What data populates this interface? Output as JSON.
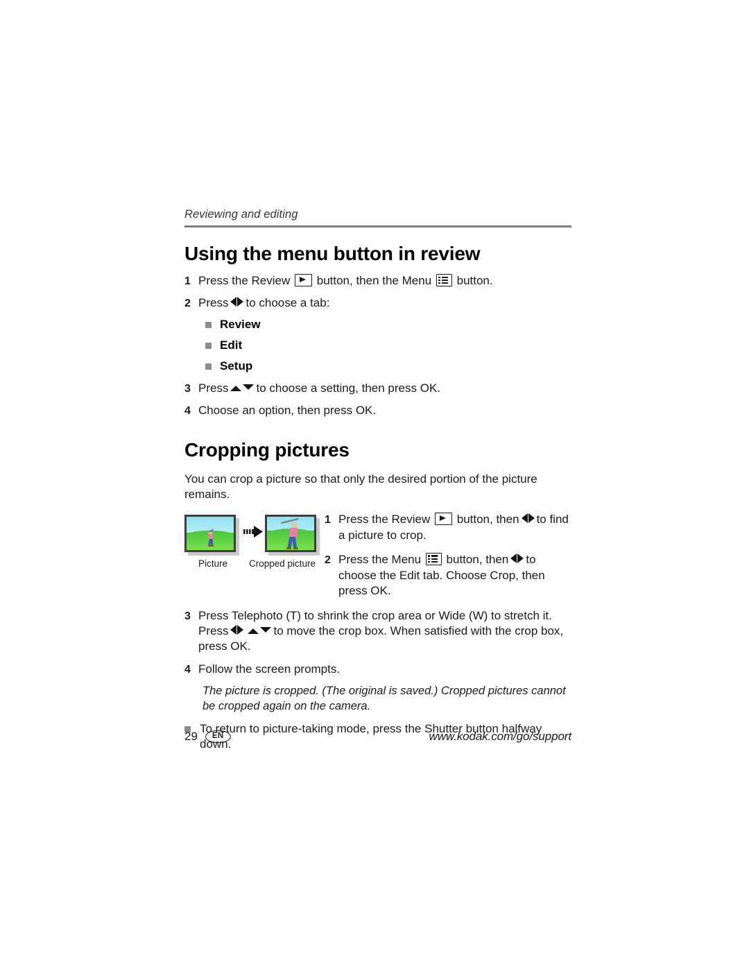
{
  "header": {
    "running_title": "Reviewing and editing"
  },
  "sections": [
    {
      "title": "Using the menu button in review",
      "steps": [
        {
          "num": "1",
          "text_a": "Press the Review",
          "text_b": "button, then the Menu",
          "text_c": "button."
        },
        {
          "num": "2",
          "text_a": "Press",
          "text_b": "to choose a tab:"
        }
      ],
      "tabs": [
        {
          "label": "Review"
        },
        {
          "label": "Edit"
        },
        {
          "label": "Setup"
        }
      ],
      "steps_after": [
        {
          "num": "3",
          "text_a": "Press",
          "text_b": "to choose a setting, then press OK."
        },
        {
          "num": "4",
          "text_a": "Choose an option, then press OK."
        }
      ]
    },
    {
      "title": "Cropping pictures",
      "intro": "You can crop a picture so that only the desired portion of the picture remains.",
      "figure": {
        "caption_original": "Picture",
        "caption_cropped": "Cropped picture",
        "arrow": "right-arrow-icon"
      },
      "crop_steps": [
        {
          "num": "1",
          "text_a": "Press the Review",
          "text_b": "button, then",
          "text_c": "to find a picture to crop."
        },
        {
          "num": "2",
          "text_a": "Press the Menu",
          "text_b": "button, then",
          "text_c": "to choose the Edit tab. Choose Crop, then press OK."
        }
      ],
      "lower_steps": [
        {
          "num": "3",
          "text_a": "Press Telephoto (T) to shrink the crop area or Wide (W) to stretch it.",
          "text_b": "Press",
          "text_c": "to move the crop box. When satisfied with the crop box, press OK."
        },
        {
          "num": "4",
          "text_a": "Follow the screen prompts."
        }
      ],
      "note_italic": "The picture is cropped. (The original is saved.) Cropped pictures cannot be cropped again on the camera.",
      "bullet_note": "To return to picture-taking mode, press the Shutter button halfway down."
    }
  ],
  "footer": {
    "page_number": "29",
    "language_code": "EN",
    "support_url": "www.kodak.com/go/support"
  },
  "colors": {
    "rule": "#7b7b7b",
    "bullet": "#8c8c8c",
    "text": "#1a1a1a",
    "sky": "#8fe0ef",
    "grass": "#4ec73f"
  }
}
